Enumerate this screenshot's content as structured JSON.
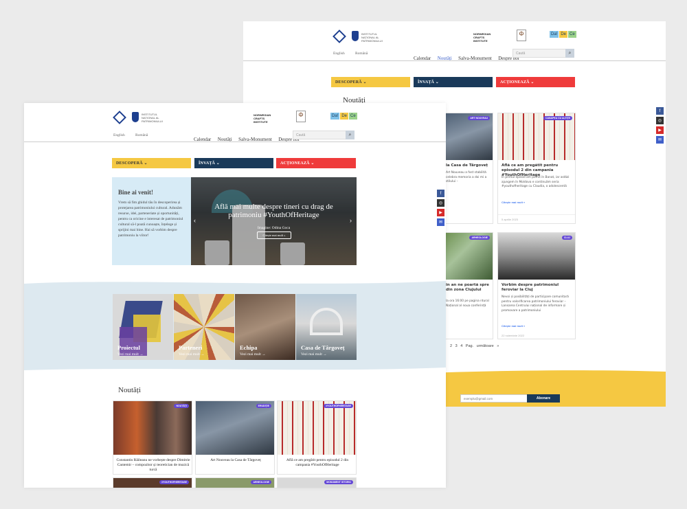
{
  "header": {
    "lang_en": "English",
    "lang_ro": "Română",
    "nav": [
      "Calendar",
      "Noutăți",
      "Salva-Monument",
      "Despre noi"
    ],
    "search_placeholder": "Caută",
    "partner_ncr": "NORWEGIAN CRAFTS INSTITUTE",
    "dadece": [
      "Da!",
      "De",
      "Ce"
    ]
  },
  "menu": {
    "descopera": "DESCOPERĂ ⌄",
    "invata": "ÎNVAȚĂ ⌄",
    "actioneaza": "ACȚIONEAZĂ ⌄"
  },
  "back": {
    "news_heading": "Noutăți",
    "cards": [
      {
        "badge": "ART NOUVEAU",
        "title": "la Casa de Târgoveț",
        "excerpt": "Art Nouveau a fost stabilită celebra memoria a doi mi a stilului –",
        "more": "",
        "date": ""
      },
      {
        "badge": "CANAPEA CU ALTIȚE",
        "title": "Află ce am pregătit pentru episodul 2 din campania #YouthOfHeritage",
        "excerpt": "În primul episod am pornit în Banat, iar astăzi ajungem în Moldova e continuăm seria #youthofheritage cu Claudia, o adolescentă",
        "more": "Citește mai mult »",
        "date": "5 aprilie 2023"
      },
      {
        "badge": "ARHEOLOGIE",
        "title": "in an ne poartă spre din zona Clujului",
        "excerpt": "la ora 16:00 pe pagina ntural Național al noua conferință",
        "more": "",
        "date": ""
      },
      {
        "badge": "CLUJ",
        "title": "Vorbim despre patrimoniul feroviar la Cluj",
        "excerpt": "Nevoi și posibilități de participare comunitară pentru valorificarea patrimoniului feroviar – Lansarea Centrului național de informare și promovare a patrimoniului",
        "more": "Citește mai mult »",
        "date": "22 noiembrie 2022"
      }
    ],
    "pagination": [
      "2",
      "3",
      "4",
      "Pag. următoare »"
    ],
    "newsletter_placeholder": "exemplu@gmail.com",
    "subscribe": "Abonare"
  },
  "front": {
    "welcome_title": "Bine ai venit!",
    "welcome_text": "Vrem să fim ghidul tău în descoperirea și protejarea patrimoniului cultural. Adunăm resurse, idei, parteneriate și oportunități, pentru ca oricine e interesat de patrimoniul cultural să-l poată cunoaște, înțelege și sprijini mai bine. Hai să vorbim despre patrimoniu la viitor!",
    "slider_title": "Află mai multe despre tineri cu drag de patrimoniu #YouthOfHeritage",
    "slider_credit": "Imagine: Odina Goca",
    "slider_button": "Citește mai mult »",
    "tiles": [
      {
        "title": "Proiectul",
        "more": "Vezi mai mult →"
      },
      {
        "title": "Parteneri",
        "more": "Vezi mai mult →"
      },
      {
        "title": "Echipa",
        "more": "Vezi mai mult →"
      },
      {
        "title": "Casa de Târgoveț",
        "more": "Vezi mai mult →"
      }
    ],
    "news_heading": "Noutăți",
    "news": [
      {
        "badge": "NOUTĂȚI",
        "title": "Constantin Răileanu ne vorbește despre Dimitrie Cantemir – compozitor și teoretician de muzică turcă"
      },
      {
        "badge": "ERUDIȚIE",
        "title": "Art Nouveau la Casa de Târgoveț"
      },
      {
        "badge": "#YOUTHOFHERITAGE",
        "title": "Află ce am pregătit pentru episodul 2 din campania #YouthOfHeritage"
      }
    ],
    "news_row2_badges": [
      "#YOUTHOFHERITAGE",
      "ARHEOLOGIE",
      "MONUMENT ISTORIC"
    ]
  },
  "colors": {
    "yellow": "#f5c842",
    "navy": "#1a3a5a",
    "red": "#ef3b3b",
    "purple": "#6347d6",
    "blue_wave": "#dce9f1"
  }
}
